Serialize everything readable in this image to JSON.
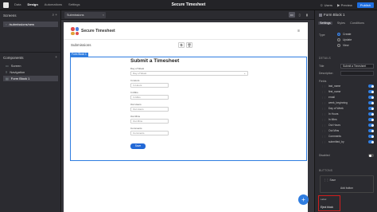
{
  "topbar": {
    "nav": [
      "Data",
      "Design",
      "Automations",
      "Settings"
    ],
    "active_nav": "Design",
    "title": "Secure Timesheet",
    "users": "Users",
    "preview": "Preview",
    "publish": "Publish"
  },
  "left": {
    "screens_heading": "Screens",
    "screens": [
      "/submissions/new"
    ],
    "components_heading": "Components",
    "components": [
      "Screen",
      "Navigation",
      "Form Block 1"
    ]
  },
  "canvas": {
    "tab_label": "Submissions"
  },
  "app": {
    "title": "Secure Timesheet",
    "subheading": "Submissions",
    "block_tag": "Form Block 1",
    "form_title": "Submit a Timesheet",
    "fields": [
      {
        "label": "Day of Week",
        "placeholder": "Day of Week",
        "type": "select"
      },
      {
        "label": "In Hours",
        "placeholder": "In Hours",
        "type": "short"
      },
      {
        "label": "In Mins",
        "placeholder": "In Mins",
        "type": "short"
      },
      {
        "label": "Out Hours",
        "placeholder": "Out Hours",
        "type": "short"
      },
      {
        "label": "Out Mins",
        "placeholder": "Out Mins",
        "type": "short"
      },
      {
        "label": "Comments",
        "placeholder": "Comments",
        "type": "short"
      }
    ],
    "save_label": "Save"
  },
  "right": {
    "heading": "Form Block 1",
    "tabs": [
      "Settings",
      "Styles",
      "Conditions"
    ],
    "type_label": "Type",
    "type_options": [
      "Create",
      "Update",
      "View"
    ],
    "type_selected": "Create",
    "details_section": "DETAILS",
    "title_label": "Title",
    "title_value": "Submit a Timesheet",
    "description_label": "Description",
    "fields_label": "Fields",
    "fields": [
      "last_name",
      "first_name",
      "email",
      "week_beginning",
      "Day of Week",
      "In Hours",
      "In Mins",
      "Out Hours",
      "Out Mins",
      "Comments",
      "submitted_by"
    ],
    "disabled_label": "Disabled",
    "buttons_section": "BUTTONS",
    "save_button": "Save",
    "add_button": "Add button",
    "bottom_label": "Label",
    "bottom_value": "Eject block"
  },
  "colors": {
    "accent": "#2f7de0",
    "highlight": "#d01e1e"
  }
}
